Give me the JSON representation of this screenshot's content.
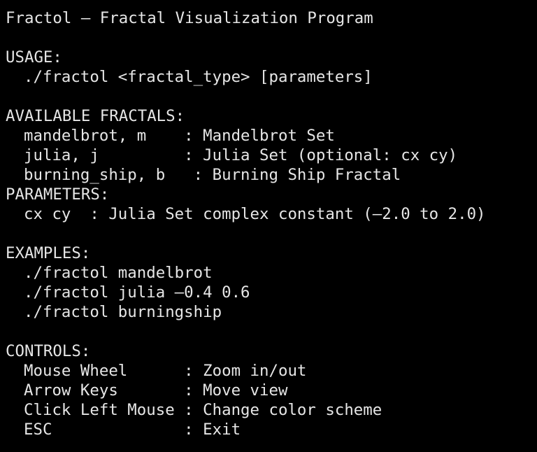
{
  "title": "Fractol – Fractal Visualization Program",
  "usage": {
    "heading": "USAGE:",
    "command": "./fractol <fractal_type> [parameters]"
  },
  "fractals": {
    "heading": "AVAILABLE FRACTALS:",
    "items": [
      "mandelbrot, m    : Mandelbrot Set",
      "julia, j         : Julia Set (optional: cx cy)",
      "burning_ship, b   : Burning Ship Fractal"
    ]
  },
  "parameters": {
    "heading": "PARAMETERS:",
    "items": [
      "cx cy  : Julia Set complex constant (–2.0 to 2.0)"
    ]
  },
  "examples": {
    "heading": "EXAMPLES:",
    "items": [
      "./fractol mandelbrot",
      "./fractol julia –0.4 0.6",
      "./fractol burningship"
    ]
  },
  "controls": {
    "heading": "CONTROLS:",
    "items": [
      "Mouse Wheel      : Zoom in/out",
      "Arrow Keys       : Move view",
      "Click Left Mouse : Change color scheme",
      "ESC              : Exit"
    ]
  }
}
